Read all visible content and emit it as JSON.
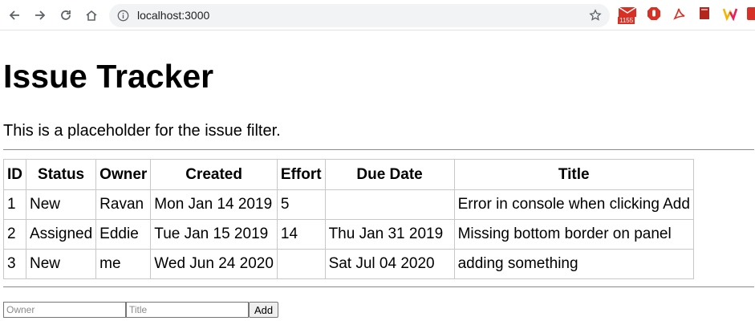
{
  "browser": {
    "url": "localhost:3000",
    "mail_badge": "1155"
  },
  "page": {
    "title": "Issue Tracker",
    "filter_placeholder": "This is a placeholder for the issue filter."
  },
  "table": {
    "headers": [
      "ID",
      "Status",
      "Owner",
      "Created",
      "Effort",
      "Due Date",
      "Title"
    ],
    "rows": [
      [
        "1",
        "New",
        "Ravan",
        "Mon Jan 14 2019",
        "5",
        "",
        "Error in console when clicking Add"
      ],
      [
        "2",
        "Assigned",
        "Eddie",
        "Tue Jan 15 2019",
        "14",
        "Thu Jan 31 2019",
        "Missing bottom border on panel"
      ],
      [
        "3",
        "New",
        "me",
        "Wed Jun 24 2020",
        "",
        "Sat Jul 04 2020",
        "adding something"
      ]
    ]
  },
  "form": {
    "owner_placeholder": "Owner",
    "title_placeholder": "Title",
    "add_label": "Add"
  }
}
